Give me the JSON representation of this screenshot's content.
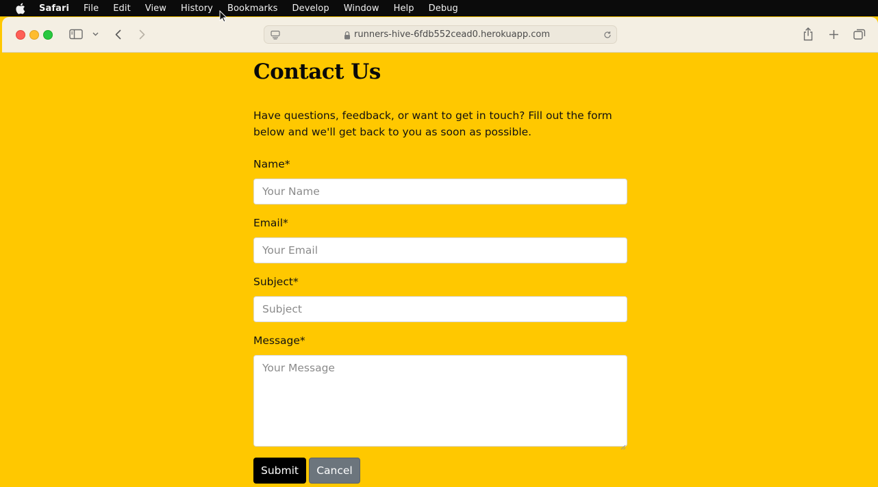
{
  "menubar": {
    "app": "Safari",
    "items": [
      "File",
      "Edit",
      "View",
      "History",
      "Bookmarks",
      "Develop",
      "Window",
      "Help",
      "Debug"
    ]
  },
  "browser": {
    "url": "runners-hive-6fdb552cead0.herokuapp.com"
  },
  "page": {
    "title": "Contact Us",
    "intro": "Have questions, feedback, or want to get in touch? Fill out the form below and we'll get back to you as soon as possible.",
    "form": {
      "name_label": "Name*",
      "name_placeholder": "Your Name",
      "email_label": "Email*",
      "email_placeholder": "Your Email",
      "subject_label": "Subject*",
      "subject_placeholder": "Subject",
      "message_label": "Message*",
      "message_placeholder": "Your Message",
      "submit_label": "Submit",
      "cancel_label": "Cancel"
    }
  },
  "colors": {
    "page_background": "#ffc800",
    "submit_button": "#000000",
    "cancel_button": "#6c757d"
  },
  "icons": [
    "apple-icon",
    "sidebar-icon",
    "chevron-down-icon",
    "back-icon",
    "forward-icon",
    "page-menu-icon",
    "lock-icon",
    "reload-icon",
    "share-icon",
    "new-tab-icon",
    "tab-overview-icon",
    "cursor-icon"
  ]
}
